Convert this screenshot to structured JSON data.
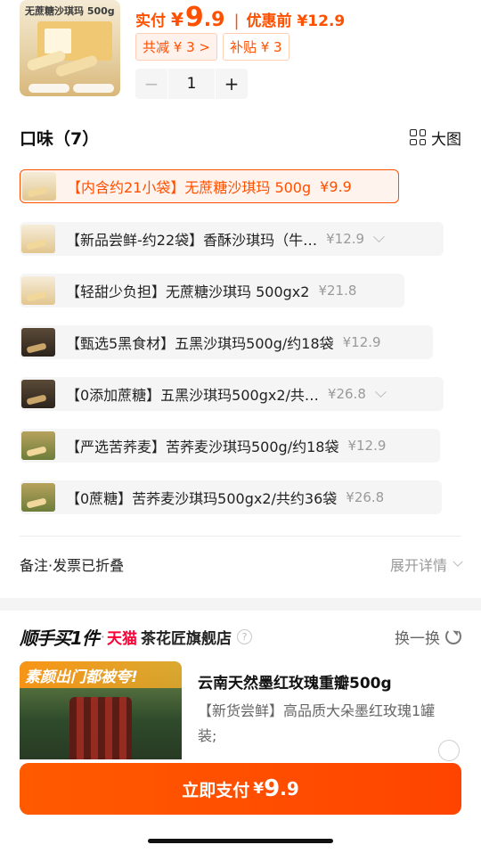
{
  "product": {
    "thumb_label": "无蔗糖沙琪玛 500g",
    "price_label": "实付",
    "currency": "¥",
    "price_int": "9",
    "price_dec": ".9",
    "separator": "|",
    "orig_price": "优惠前 ¥12.9",
    "discount_chip": "共减 ¥ 3 >",
    "subsidy_chip": "补贴 ¥ 3",
    "quantity": "1",
    "minus": "−",
    "plus": "+"
  },
  "flavor": {
    "title": "口味（7）",
    "big_view_label": "大图",
    "options": [
      {
        "name": "【内含约21小袋】无蔗糖沙琪玛 500g",
        "price": "¥9.9",
        "selected": true,
        "thumb": "light"
      },
      {
        "name": "【新品尝鲜-约22袋】香酥沙琪玛（牛…",
        "price": "¥12.9",
        "selected": false,
        "thumb": "light",
        "expand": true
      },
      {
        "name": "【轻甜少负担】无蔗糖沙琪玛 500gx2",
        "price": "¥21.8",
        "selected": false,
        "thumb": "light"
      },
      {
        "name": "【甄选5黑食材】五黑沙琪玛500g/约18袋",
        "price": "¥12.9",
        "selected": false,
        "thumb": "dark"
      },
      {
        "name": "【0添加蔗糖】五黑沙琪玛500gx2/共…",
        "price": "¥26.8",
        "selected": false,
        "thumb": "dark",
        "expand": true
      },
      {
        "name": "【严选苦荞麦】苦荞麦沙琪玛500g/约18袋",
        "price": "¥12.9",
        "selected": false,
        "thumb": "green"
      },
      {
        "name": "【0蔗糖】苦荞麦沙琪玛500gx2/共约36袋",
        "price": "¥26.8",
        "selected": false,
        "thumb": "green"
      }
    ]
  },
  "remark": {
    "label": "备注·发票已折叠",
    "expand": "展开详情"
  },
  "recommend": {
    "brand": "顺手买1件",
    "dot": "·",
    "platform": "天猫",
    "shop": "茶花匠旗舰店",
    "help": "?",
    "swap": "换一换",
    "banner": "素颜出门都被夸!",
    "title": "云南天然墨红玫瑰重瓣500g",
    "desc": "【新货尝鲜】高品质大朵墨红玫瑰1罐装;"
  },
  "pay": {
    "label": "立即支付",
    "currency": "¥",
    "int": "9",
    "dec": ".9"
  },
  "colors": {
    "accent": "#ff5000",
    "tmall_red": "#ff0036"
  }
}
